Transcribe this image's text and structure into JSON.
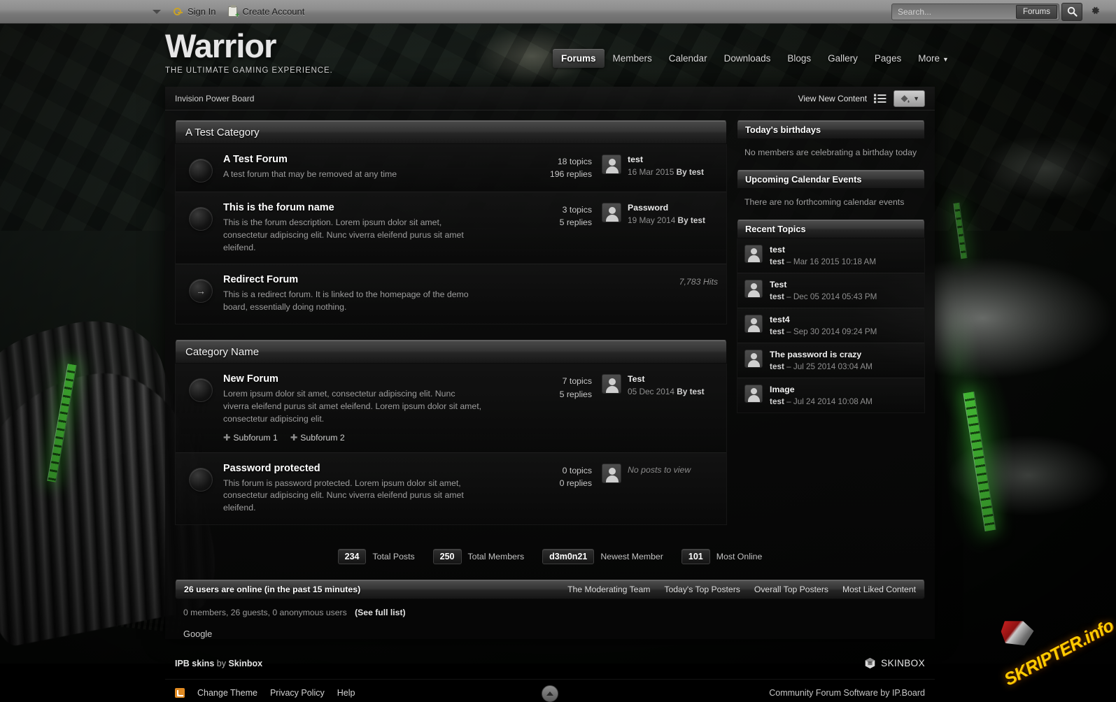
{
  "userbar": {
    "sign_in": "Sign In",
    "create_account": "Create Account",
    "search_placeholder": "Search...",
    "search_value": "",
    "search_scope": "Forums"
  },
  "logo": {
    "name": "Warrior",
    "tagline": "THE ULTIMATE GAMING EXPERIENCE."
  },
  "nav": {
    "items": [
      {
        "label": "Forums",
        "active": true
      },
      {
        "label": "Members",
        "active": false
      },
      {
        "label": "Calendar",
        "active": false
      },
      {
        "label": "Downloads",
        "active": false
      },
      {
        "label": "Blogs",
        "active": false
      },
      {
        "label": "Gallery",
        "active": false
      },
      {
        "label": "Pages",
        "active": false
      },
      {
        "label": "More",
        "active": false,
        "chevron": true
      }
    ]
  },
  "toolbar": {
    "breadcrumb": "Invision Power Board",
    "view_new_content": "View New Content"
  },
  "categories": [
    {
      "title": "A Test Category",
      "forums": [
        {
          "title": "A Test Forum",
          "description": "A test forum that may be removed at any time",
          "topics": "18 topics",
          "replies": "196 replies",
          "last_title": "test",
          "last_date": "16 Mar 2015",
          "last_by_label": "By",
          "last_by": "test",
          "type": "normal",
          "subforums": []
        },
        {
          "title": "This is the forum name",
          "description": "This is the forum description. Lorem ipsum dolor sit amet, consectetur adipiscing elit. Nunc viverra eleifend purus sit amet eleifend.",
          "topics": "3 topics",
          "replies": "5 replies",
          "last_title": "Password",
          "last_date": "19 May 2014",
          "last_by_label": "By",
          "last_by": "test",
          "type": "normal",
          "subforums": []
        },
        {
          "title": "Redirect Forum",
          "description": "This is a redirect forum. It is linked to the homepage of the demo board, essentially doing nothing.",
          "hits": "7,783 Hits",
          "type": "redirect",
          "subforums": []
        }
      ]
    },
    {
      "title": "Category Name",
      "forums": [
        {
          "title": "New Forum",
          "description": "Lorem ipsum dolor sit amet, consectetur adipiscing elit. Nunc viverra eleifend purus sit amet eleifend. Lorem ipsum dolor sit amet, consectetur adipiscing elit.",
          "topics": "7 topics",
          "replies": "5 replies",
          "last_title": "Test",
          "last_date": "05 Dec 2014",
          "last_by_label": "By",
          "last_by": "test",
          "type": "normal",
          "subforums": [
            "Subforum 1",
            "Subforum 2"
          ]
        },
        {
          "title": "Password protected",
          "description": "This forum is password protected. Lorem ipsum dolor sit amet, consectetur adipiscing elit. Nunc viverra eleifend purus sit amet eleifend.",
          "topics": "0 topics",
          "replies": "0 replies",
          "no_posts": "No posts to view",
          "type": "locked",
          "subforums": []
        }
      ]
    }
  ],
  "board_stats": [
    {
      "number": "234",
      "label": "Total Posts"
    },
    {
      "number": "250",
      "label": "Total Members"
    },
    {
      "number": "d3m0n21",
      "label": "Newest Member"
    },
    {
      "number": "101",
      "label": "Most Online"
    }
  ],
  "sidebar": {
    "birthdays": {
      "title": "Today's birthdays",
      "empty": "No members are celebrating a birthday today"
    },
    "calendar": {
      "title": "Upcoming Calendar Events",
      "empty": "There are no forthcoming calendar events"
    },
    "recent_topics": {
      "title": "Recent Topics",
      "items": [
        {
          "title": "test",
          "author": "test",
          "sep": "–",
          "date": "Mar 16 2015 10:18 AM"
        },
        {
          "title": "Test",
          "author": "test",
          "sep": "–",
          "date": "Dec 05 2014 05:43 PM"
        },
        {
          "title": "test4",
          "author": "test",
          "sep": "–",
          "date": "Sep 30 2014 09:24 PM"
        },
        {
          "title": "The password is crazy",
          "author": "test",
          "sep": "–",
          "date": "Jul 25 2014 03:04 AM"
        },
        {
          "title": "Image",
          "author": "test",
          "sep": "–",
          "date": "Jul 24 2014 10:08 AM"
        }
      ]
    }
  },
  "online": {
    "title": "26 users are online (in the past 15 minutes)",
    "links": [
      "The Moderating Team",
      "Today's Top Posters",
      "Overall Top Posters",
      "Most Liked Content"
    ],
    "breakdown": "0 members, 26 guests, 0 anonymous users",
    "full_list": "(See full list)",
    "google": "Google"
  },
  "footer": {
    "skin_prefix": "IPB skins",
    "skin_by": "by",
    "skin_author": "Skinbox",
    "skinbox_logo": "SKINBOX",
    "links": [
      "Change Theme",
      "Privacy Policy",
      "Help"
    ],
    "copyright": "Community Forum Software by IP.Board"
  },
  "watermark": {
    "text": "SKRIPTER.info"
  },
  "colors": {
    "accent_green": "#56ee42",
    "header_dark": "#262626",
    "text_primary": "#ffffff",
    "text_muted": "#9d9d9d",
    "rss_orange": "#e08a22",
    "watermark_yellow": "#ffcc00"
  }
}
